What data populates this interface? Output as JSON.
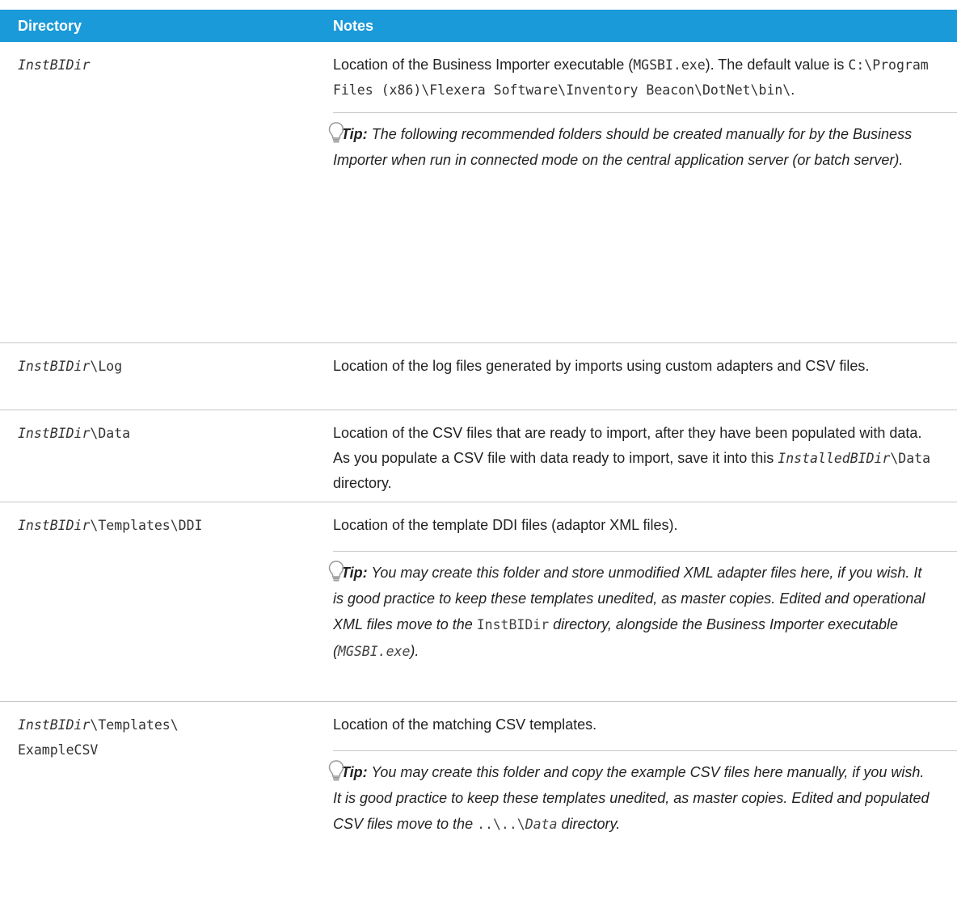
{
  "header": {
    "directory": "Directory",
    "notes": "Notes"
  },
  "tip_label": "Tip:",
  "rows": [
    {
      "dir": {
        "var": "InstBIDir",
        "suffix": ""
      },
      "note": {
        "t1": "Location of the Business Importer executable (",
        "code1": "MGSBI.exe",
        "t2": "). The default value is ",
        "code2": "C:\\Program Files (x86)\\Flexera Software\\Inventory Beacon\\DotNet\\bin\\",
        "t3": "."
      },
      "tip": {
        "t1": "The following recommended folders should be created manually for by the Business Importer when run in connected mode on the central application server (or batch server)."
      }
    },
    {
      "dir": {
        "var": "InstBIDir",
        "suffix": "\\Log"
      },
      "note": {
        "t1": "Location of the log files generated by imports using custom adapters and CSV files."
      }
    },
    {
      "dir": {
        "var": "InstBIDir",
        "suffix": "\\Data"
      },
      "note": {
        "t1": "Location of the CSV files that are ready to import, after they have been populated with data. As you populate a CSV file with data ready to import, save it into this ",
        "code1": "InstalledBIDir",
        "code2": "\\Data",
        "t2": " directory."
      }
    },
    {
      "dir": {
        "var": "InstBIDir",
        "suffix": "\\Templates\\DDI"
      },
      "note": {
        "t1": "Location of the template DDI files (adaptor XML files)."
      },
      "tip": {
        "t1": "You may create this folder and store unmodified XML adapter files here, if you wish. It is good practice to keep these templates unedited, as master copies. Edited and operational XML files move to the ",
        "code1": "InstBIDir",
        "t2": " directory, alongside the Business Importer executable (",
        "code2": "MGSBI.exe",
        "t3": ")."
      }
    },
    {
      "dir": {
        "var": "InstBIDir",
        "suffix": "\\Templates\\",
        "line2": "ExampleCSV"
      },
      "note": {
        "t1": "Location of the matching CSV templates."
      },
      "tip": {
        "t1": "You may create this folder and copy the example CSV files here manually, if you wish. It is good practice to keep these templates unedited, as master copies. Edited and populated CSV files move to the ",
        "code1": "..\\..\\",
        "code2": "Data",
        "t2": " directory."
      }
    }
  ]
}
